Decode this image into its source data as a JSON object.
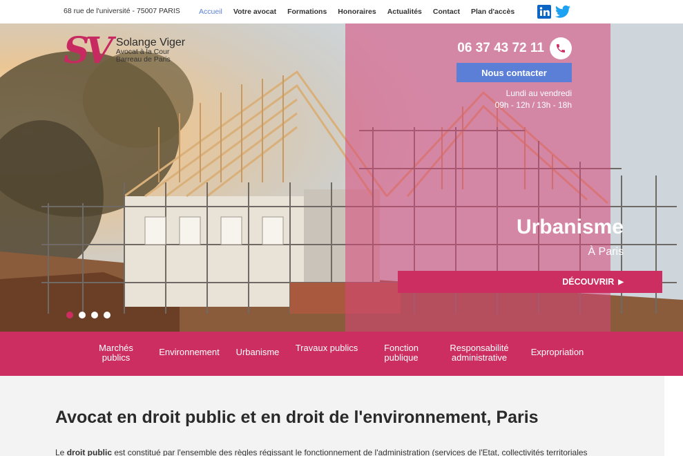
{
  "topbar": {
    "address": "68 rue de l'université - 75007 PARIS",
    "nav": [
      {
        "label": "Accueil",
        "active": true
      },
      {
        "label": "Votre avocat"
      },
      {
        "label": "Formations"
      },
      {
        "label": "Honoraires"
      },
      {
        "label": "Actualités"
      },
      {
        "label": "Contact"
      },
      {
        "label": "Plan d'accès"
      }
    ],
    "social": [
      {
        "icon": "linkedin-icon",
        "color": "#0a66c2"
      },
      {
        "icon": "twitter-icon",
        "color": "#1da1f2"
      }
    ]
  },
  "logo": {
    "mark": "SV",
    "name": "Solange Viger",
    "line1": "Avocat à la Cour",
    "line2": "Barreau de Paris"
  },
  "hero": {
    "phone": "06 37 43 72 11",
    "contact_button": "Nous contacter",
    "hours_line1": "Lundi au vendredi",
    "hours_line2": "09h - 12h / 13h - 18h",
    "slide_title": "Urbanisme",
    "slide_subtitle": "À Paris",
    "discover_button": "DÉCOUVRIR",
    "slide_count": 4,
    "active_slide": 1
  },
  "categories": [
    {
      "line1": "Marchés",
      "line2": "publics"
    },
    {
      "line1": "Environnement",
      "line2": ""
    },
    {
      "line1": "Urbanisme",
      "line2": ""
    },
    {
      "line1": "Travaux publics",
      "line2": ""
    },
    {
      "line1": "Fonction",
      "line2": "publique"
    },
    {
      "line1": "Responsabilité",
      "line2": "administrative"
    },
    {
      "line1": "Expropriation",
      "line2": ""
    }
  ],
  "content": {
    "headline": "Avocat en droit public et en droit de l'environnement, Paris",
    "paragraph_prefix": "Le ",
    "paragraph_bold": "droit public",
    "paragraph_rest": " est constitué par l'ensemble des règles régissant le fonctionnement de l'administration (services de l'Etat, collectivités territoriales"
  },
  "colors": {
    "brand_pink": "#cc2e62",
    "accent_blue": "#5b7fd6"
  }
}
